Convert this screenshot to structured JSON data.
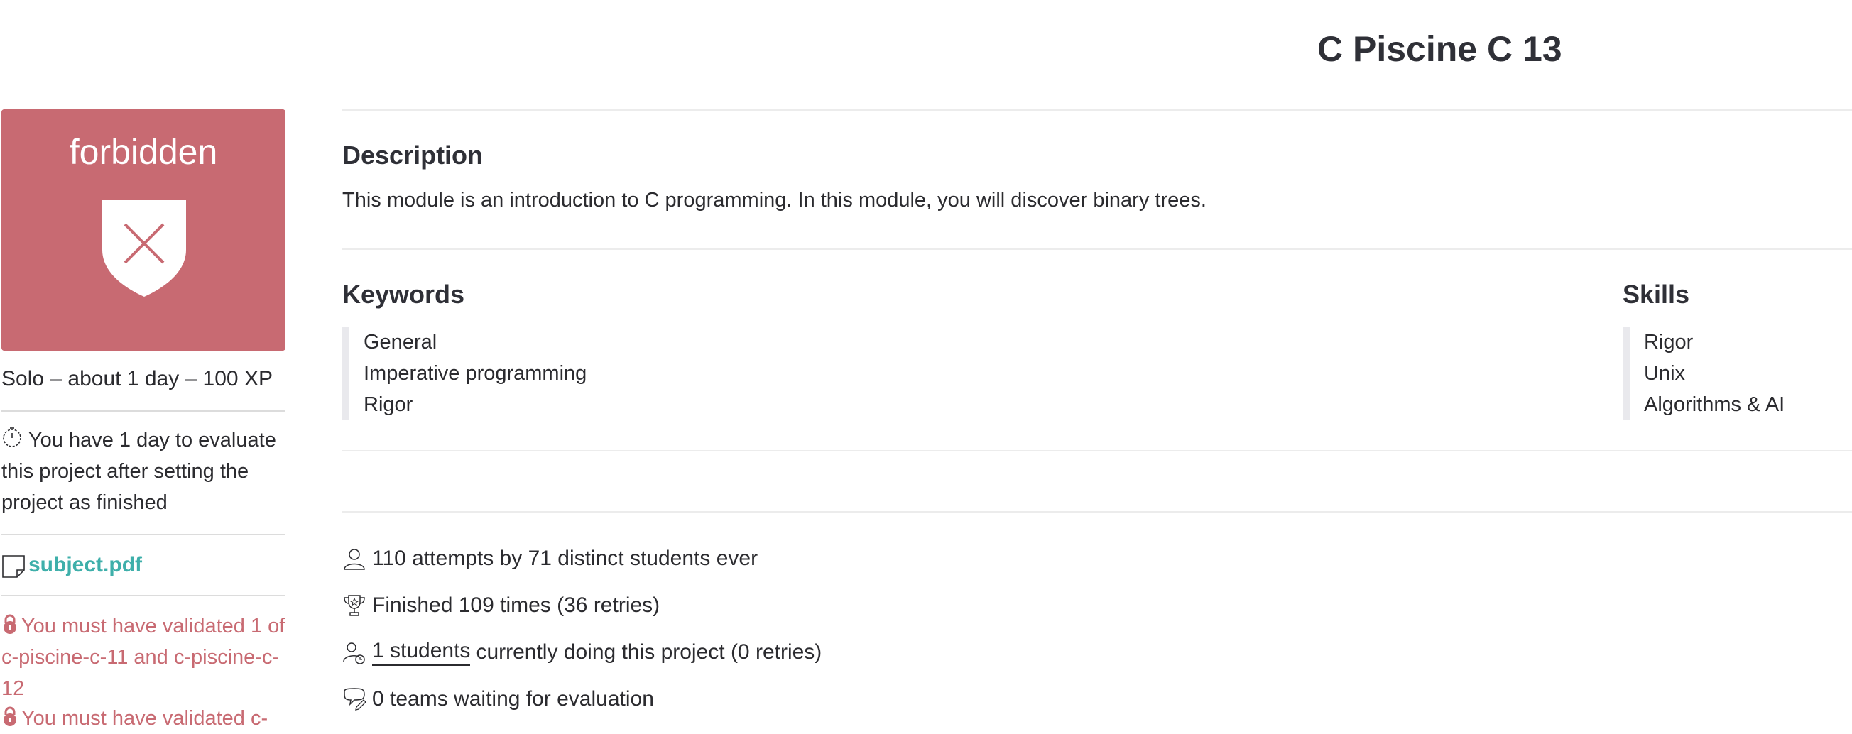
{
  "page": {
    "title": "C Piscine C 13"
  },
  "sidebar": {
    "badge": {
      "status": "forbidden",
      "color": "#c86a72",
      "icon": "shield-x-icon"
    },
    "meta": "Solo – about 1 day – 100 XP",
    "evaluation_notice": "You have 1 day to evaluate this project after setting the project as finished",
    "subject_link": "subject.pdf",
    "requirements": [
      "You must have validated 1 of c-piscine-c-11 and c-piscine-c-12",
      "You must have validated c-"
    ]
  },
  "main": {
    "description": {
      "heading": "Description",
      "text": "This module is an introduction to C programming. In this module, you will discover binary trees."
    },
    "keywords": {
      "heading": "Keywords",
      "items": [
        "General",
        "Imperative programming",
        "Rigor"
      ]
    },
    "skills": {
      "heading": "Skills",
      "items": [
        "Rigor",
        "Unix",
        "Algorithms & AI"
      ]
    },
    "stats": {
      "attempts": "110 attempts by 71 distinct students ever",
      "finished": "Finished 109 times (36 retries)",
      "students_link": "1 students",
      "students_rest": "currently doing this project (0 retries)",
      "teams_waiting": "0 teams waiting for evaluation"
    }
  },
  "colors": {
    "accent_link": "#3eafaa",
    "danger": "#c86a72",
    "text": "#2b2b2f"
  }
}
